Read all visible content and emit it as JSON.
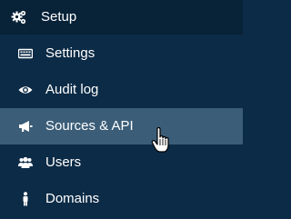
{
  "menu": {
    "header": {
      "label": "Setup",
      "icon": "gears-icon"
    },
    "items": [
      {
        "label": "Settings",
        "icon": "keyboard-icon",
        "active": false
      },
      {
        "label": "Audit log",
        "icon": "eye-icon",
        "active": false
      },
      {
        "label": "Sources & API",
        "icon": "megaphone-icon",
        "active": true
      },
      {
        "label": "Users",
        "icon": "users-icon",
        "active": false
      },
      {
        "label": "Domains",
        "icon": "person-icon",
        "active": false
      }
    ]
  },
  "colors": {
    "sidebar_bg": "#0c2b46",
    "header_bg": "#082238",
    "active_bg": "#3b5d78",
    "text": "#ffffff"
  }
}
